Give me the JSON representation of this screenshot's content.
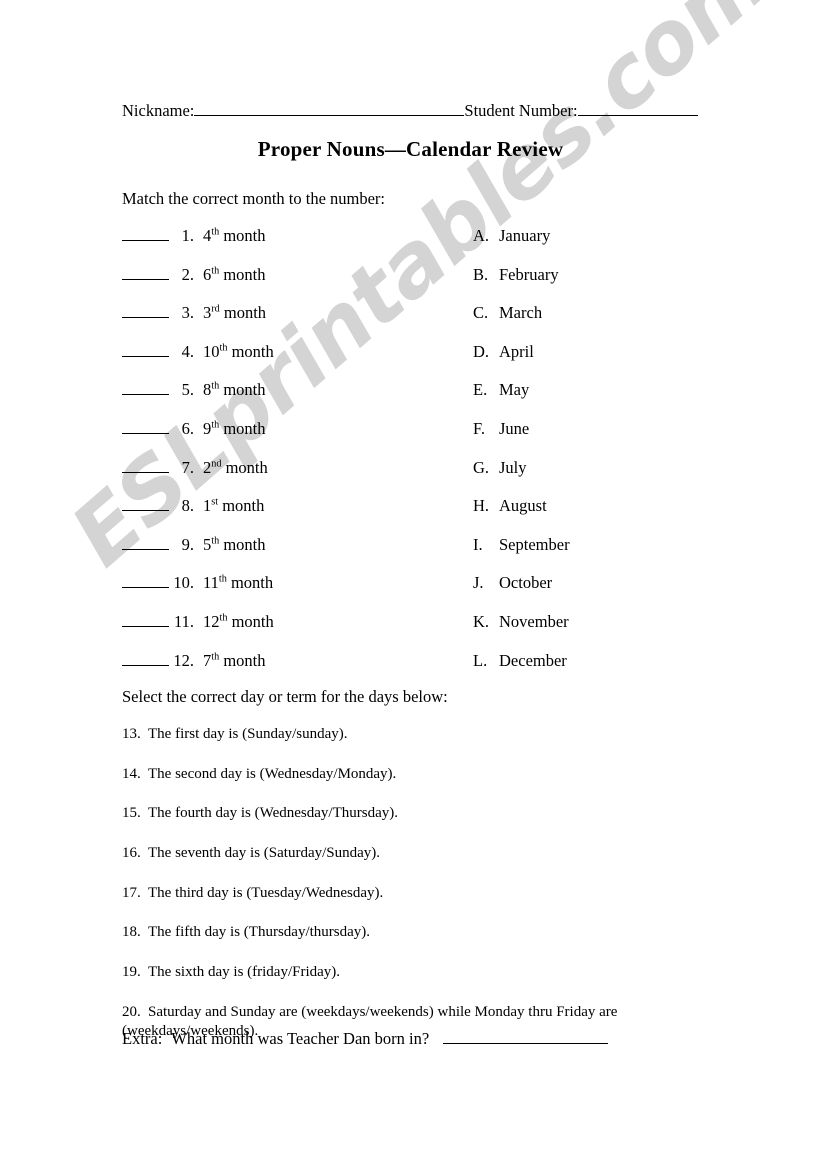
{
  "document": {
    "title": "Proper Nouns—Calendar Review",
    "watermark": "ESLprintables.com",
    "watermark_color": "#d4d4d4"
  },
  "header": {
    "nickname_label": "Nickname:",
    "student_number_label": "Student Number:"
  },
  "matching_section": {
    "instruction": "Match the correct month to the number:",
    "items": [
      {
        "number": "1.",
        "ordinal": "4",
        "suffix": "th",
        "text": "month"
      },
      {
        "number": "2.",
        "ordinal": "6",
        "suffix": "th",
        "text": "month"
      },
      {
        "number": "3.",
        "ordinal": "3",
        "suffix": "rd",
        "text": "month"
      },
      {
        "number": "4.",
        "ordinal": "10",
        "suffix": "th",
        "text": "month"
      },
      {
        "number": "5.",
        "ordinal": "8",
        "suffix": "th",
        "text": "month"
      },
      {
        "number": "6.",
        "ordinal": "9",
        "suffix": "th",
        "text": "month"
      },
      {
        "number": "7.",
        "ordinal": "2",
        "suffix": "nd",
        "text": "month"
      },
      {
        "number": "8.",
        "ordinal": "1",
        "suffix": "st",
        "text": "month"
      },
      {
        "number": "9.",
        "ordinal": "5",
        "suffix": "th",
        "text": "month"
      },
      {
        "number": "10.",
        "ordinal": "11",
        "suffix": "th",
        "text": "month"
      },
      {
        "number": "11.",
        "ordinal": "12",
        "suffix": "th",
        "text": "month"
      },
      {
        "number": "12.",
        "ordinal": "7",
        "suffix": "th",
        "text": "month"
      }
    ],
    "options": [
      {
        "letter": "A.",
        "month": "January"
      },
      {
        "letter": "B.",
        "month": "February"
      },
      {
        "letter": "C.",
        "month": "March"
      },
      {
        "letter": "D.",
        "month": "April"
      },
      {
        "letter": "E.",
        "month": "May"
      },
      {
        "letter": "F.",
        "month": "June"
      },
      {
        "letter": "G.",
        "month": "July"
      },
      {
        "letter": "H.",
        "month": "August"
      },
      {
        "letter": "I.",
        "month": "September"
      },
      {
        "letter": "J.",
        "month": "October"
      },
      {
        "letter": "K.",
        "month": "November"
      },
      {
        "letter": "L.",
        "month": "December"
      }
    ]
  },
  "days_section": {
    "instruction": "Select the correct day or term for the days below:",
    "questions": [
      {
        "number": "13.",
        "text": "The first day is (Sunday/sunday)."
      },
      {
        "number": "14.",
        "text": "The second day is (Wednesday/Monday)."
      },
      {
        "number": "15.",
        "text": "The fourth day is (Wednesday/Thursday)."
      },
      {
        "number": "16.",
        "text": "The seventh day is (Saturday/Sunday)."
      },
      {
        "number": "17.",
        "text": "The third day is (Tuesday/Wednesday)."
      },
      {
        "number": "18.",
        "text": "The fifth day is (Thursday/thursday)."
      },
      {
        "number": "19.",
        "text": "The sixth day is (friday/Friday)."
      },
      {
        "number": "20.",
        "text": "Saturday and Sunday are (weekdays/weekends) while Monday thru Friday are (weekdays/weekends)."
      }
    ]
  },
  "extra": {
    "label": "Extra:",
    "question": "What month was Teacher Dan born in?"
  }
}
